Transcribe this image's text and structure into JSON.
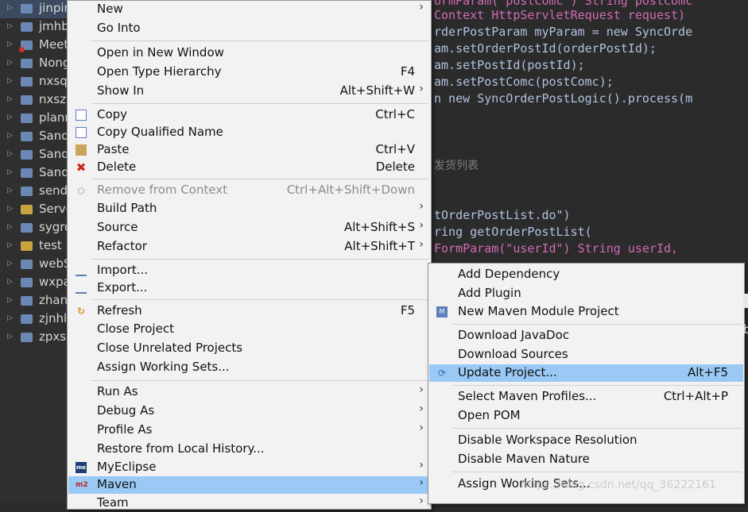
{
  "tree": {
    "items": [
      {
        "label": "jinpin",
        "icon": "maven-project-icon"
      },
      {
        "label": "jmhb",
        "icon": "maven-project-icon"
      },
      {
        "label": "Meet",
        "icon": "maven-project-error-icon"
      },
      {
        "label": "Nong",
        "icon": "maven-project-icon"
      },
      {
        "label": "nxsq",
        "icon": "maven-project-icon"
      },
      {
        "label": "nxszy",
        "icon": "maven-project-icon"
      },
      {
        "label": "plann",
        "icon": "maven-project-icon"
      },
      {
        "label": "Sand",
        "icon": "maven-project-icon"
      },
      {
        "label": "Sand",
        "icon": "maven-project-icon"
      },
      {
        "label": "Sand",
        "icon": "maven-project-icon"
      },
      {
        "label": "send",
        "icon": "maven-project-icon"
      },
      {
        "label": "Serve",
        "icon": "folder-icon"
      },
      {
        "label": "sygro",
        "icon": "maven-project-icon"
      },
      {
        "label": "test",
        "icon": "folder-icon"
      },
      {
        "label": "webS",
        "icon": "maven-project-icon"
      },
      {
        "label": "wxpa",
        "icon": "maven-project-icon"
      },
      {
        "label": "zhang",
        "icon": "maven-project-icon"
      },
      {
        "label": "zjnhl",
        "icon": "maven-project-icon"
      },
      {
        "label": "zpxsz",
        "icon": "maven-project-icon"
      }
    ]
  },
  "editor": {
    "lines": [
      "ormParam(\"postComc\") String postComc",
      "Context HttpServletRequest request)",
      "rderPostParam myParam = new SyncOrde",
      "am.setOrderPostId(orderPostId);",
      "am.setPostId(postId);",
      "am.setPostComc(postComc);",
      "n new SyncOrderPostLogic().process(m",
      "发货列表",
      "tOrderPostList.do\")",
      "ring getOrderPostList(",
      "FormParam(\"userId\") String userId,"
    ]
  },
  "main_menu": {
    "items": {
      "new": {
        "label": "New"
      },
      "go_into": {
        "label": "Go Into"
      },
      "open_new_window": {
        "label": "Open in New Window"
      },
      "open_type_hierarchy": {
        "label": "Open Type Hierarchy",
        "shortcut": "F4"
      },
      "show_in": {
        "label": "Show In",
        "shortcut": "Alt+Shift+W"
      },
      "copy": {
        "label": "Copy",
        "shortcut": "Ctrl+C"
      },
      "copy_qualified": {
        "label": "Copy Qualified Name"
      },
      "paste": {
        "label": "Paste",
        "shortcut": "Ctrl+V"
      },
      "delete": {
        "label": "Delete",
        "shortcut": "Delete"
      },
      "remove_context": {
        "label": "Remove from Context",
        "shortcut": "Ctrl+Alt+Shift+Down"
      },
      "build_path": {
        "label": "Build Path"
      },
      "source": {
        "label": "Source",
        "shortcut": "Alt+Shift+S"
      },
      "refactor": {
        "label": "Refactor",
        "shortcut": "Alt+Shift+T"
      },
      "import": {
        "label": "Import..."
      },
      "export": {
        "label": "Export..."
      },
      "refresh": {
        "label": "Refresh",
        "shortcut": "F5"
      },
      "close_project": {
        "label": "Close Project"
      },
      "close_unrelated": {
        "label": "Close Unrelated Projects"
      },
      "assign_working_sets": {
        "label": "Assign Working Sets..."
      },
      "run_as": {
        "label": "Run As"
      },
      "debug_as": {
        "label": "Debug As"
      },
      "profile_as": {
        "label": "Profile As"
      },
      "restore_history": {
        "label": "Restore from Local History..."
      },
      "myeclipse": {
        "label": "MyEclipse",
        "icon_text": "me"
      },
      "maven": {
        "label": "Maven",
        "icon_text": "m2"
      },
      "team": {
        "label": "Team"
      }
    },
    "submenu_arrow": "›"
  },
  "maven_menu": {
    "items": {
      "add_dependency": {
        "label": "Add Dependency"
      },
      "add_plugin": {
        "label": "Add Plugin"
      },
      "new_module": {
        "label": "New Maven Module Project"
      },
      "download_javadoc": {
        "label": "Download JavaDoc"
      },
      "download_sources": {
        "label": "Download Sources"
      },
      "update_project": {
        "label": "Update Project...",
        "shortcut": "Alt+F5"
      },
      "select_profiles": {
        "label": "Select Maven Profiles...",
        "shortcut": "Ctrl+Alt+P"
      },
      "open_pom": {
        "label": "Open POM"
      },
      "disable_workspace": {
        "label": "Disable Workspace Resolution"
      },
      "disable_nature": {
        "label": "Disable Maven Nature"
      },
      "assign_working_sets": {
        "label": "Assign Working Sets..."
      }
    }
  },
  "watermark": "https://blog.csdn.net/qq_36222161",
  "colors": {
    "menu_bg": "#f2f2f2",
    "highlight": "#99c9f4",
    "editor_bg": "#2b2b2b",
    "keyword": "#cc7832",
    "annotation": "#d16bb6",
    "string": "#4cc07a"
  }
}
